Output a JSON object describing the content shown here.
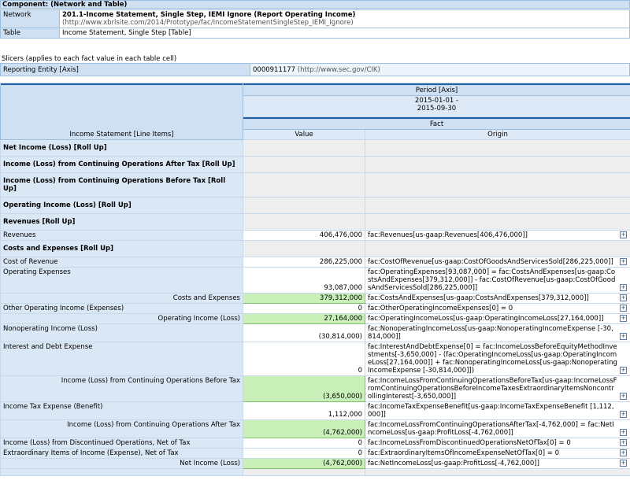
{
  "component": {
    "title": "Component: (Network and Table)",
    "network_label": "Network",
    "network_name": "201.1-Income Statement, Single Step, IEMI Ignore (Report Operating Income)",
    "network_url": "(http://www.xbrlsite.com/2014/Prototype/fac/IncomeStatementSingleStep_IEMI_Ignore)",
    "table_label": "Table",
    "table_name": "Income Statement, Single Step [Table]"
  },
  "slicers": {
    "caption": "Slicers (applies to each fact value in each table cell)",
    "axis": "Reporting Entity [Axis]",
    "value": "0000911177",
    "value_url": "(http://www.sec.gov/CIK)"
  },
  "header": {
    "period_axis": "Period [Axis]",
    "period_value": "2015-01-01 -\n2015-09-30",
    "fact": "Fact",
    "line_items": "Income Statement [Line Items]",
    "value_col": "Value",
    "origin_col": "Origin"
  },
  "rows": [
    {
      "label": "Net Income (Loss) [Roll Up]",
      "type": "abstract"
    },
    {
      "label": "Income (Loss) from Continuing Operations After Tax [Roll Up]",
      "type": "abstract"
    },
    {
      "label": "Income (Loss) from Continuing Operations Before Tax [Roll Up]",
      "type": "abstract"
    },
    {
      "label": "Operating Income (Loss) [Roll Up]",
      "type": "abstract"
    },
    {
      "label": "Revenues [Roll Up]",
      "type": "abstract"
    },
    {
      "label": "Revenues",
      "value": "406,476,000",
      "origin": "fac:Revenues[us-gaap:Revenues[406,476,000]]"
    },
    {
      "label": "Costs and Expenses [Roll Up]",
      "type": "abstract"
    },
    {
      "label": "Cost of Revenue",
      "value": "286,225,000",
      "origin": "fac:CostOfRevenue[us-gaap:CostOfGoodsAndServicesSold[286,225,000]]"
    },
    {
      "label": "Operating Expenses",
      "value": "93,087,000",
      "origin": "fac:OperatingExpenses[93,087,000] = fac:CostsAndExpenses[us-gaap:CostsAndExpenses[379,312,000]] - fac:CostOfRevenue[us-gaap:CostOfGoodsAndServicesSold[286,225,000]]"
    },
    {
      "label": "Costs and Expenses",
      "value": "379,312,000",
      "origin": "fac:CostsAndExpenses[us-gaap:CostsAndExpenses[379,312,000]]",
      "type": "total"
    },
    {
      "label": "Other Operating Income (Expenses)",
      "value": "0",
      "origin": "fac:OtherOperatingIncomeExpenses[0] = 0"
    },
    {
      "label": "Operating Income (Loss)",
      "value": "27,164,000",
      "origin": "fac:OperatingIncomeLoss[us-gaap:OperatingIncomeLoss[27,164,000]]",
      "type": "total"
    },
    {
      "label": "Nonoperating Income (Loss)",
      "value": "(30,814,000)",
      "origin": "fac:NonoperatingIncomeLoss[us-gaap:NonoperatingIncomeExpense [-30,814,000]]"
    },
    {
      "label": "Interest and Debt Expense",
      "value": "0",
      "origin": "fac:InterestAndDebtExpense[0] = fac:IncomeLossBeforeEquityMethodInvestments[-3,650,000] - (fac:OperatingIncomeLoss[us-gaap:OperatingIncomeLoss[27,164,000]] + fac:NonoperatingIncomeLoss[us-gaap:NonoperatingIncomeExpense [-30,814,000]])"
    },
    {
      "label": "Income (Loss) from Continuing Operations Before Tax",
      "value": "(3,650,000)",
      "origin": "fac:IncomeLossFromContinuingOperationsBeforeTax[us-gaap:IncomeLossFromContinuingOperationsBeforeIncomeTaxesExtraordinaryItemsNoncontrollingInterest[-3,650,000]]",
      "type": "total"
    },
    {
      "label": "Income Tax Expense (Benefit)",
      "value": "1,112,000",
      "origin": "fac:IncomeTaxExpenseBenefit[us-gaap:IncomeTaxExpenseBenefit [1,112,000]]"
    },
    {
      "label": "Income (Loss) from Continuing Operations After Tax",
      "value": "(4,762,000)",
      "origin": "fac:IncomeLossFromContinuingOperationsAfterTax[-4,762,000] = fac:NetIncomeLoss[us-gaap:ProfitLoss[-4,762,000]]",
      "type": "total"
    },
    {
      "label": "Income (Loss) from Discontinued Operations, Net of Tax",
      "value": "0",
      "origin": "fac:IncomeLossFromDiscontinuedOperationsNetOfTax[0] = 0"
    },
    {
      "label": "Extraordinary Items of Income (Expense), Net of Tax",
      "value": "0",
      "origin": "fac:ExtraordinaryItemsOfIncomeExpenseNetOfTax[0] = 0"
    },
    {
      "label": "Net Income (Loss)",
      "value": "(4,762,000)",
      "origin": "fac:NetIncomeLoss[us-gaap:ProfitLoss[-4,762,000]]",
      "type": "total"
    },
    {
      "label": "",
      "type": "blank"
    }
  ]
}
